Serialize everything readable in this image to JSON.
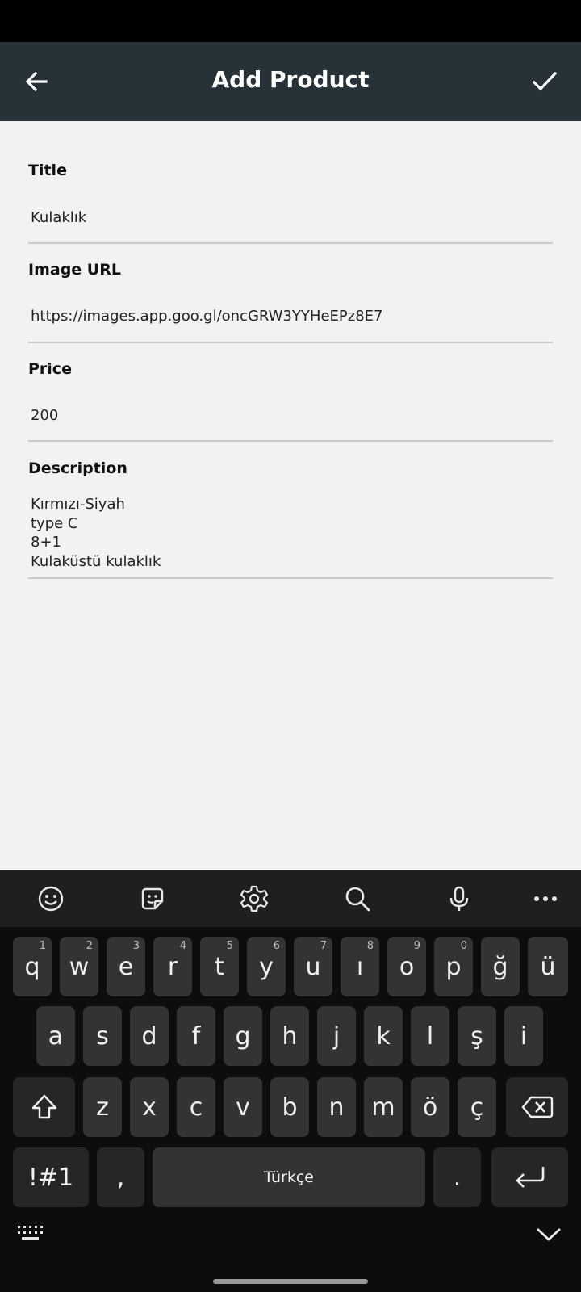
{
  "app_bar": {
    "title": "Add Product"
  },
  "form": {
    "title": {
      "label": "Title",
      "value": "Kulaklık"
    },
    "image_url": {
      "label": "Image URL",
      "value": "https://images.app.goo.gl/oncGRW3YYHeEPz8E7"
    },
    "price": {
      "label": "Price",
      "value": "200"
    },
    "description": {
      "label": "Description",
      "lines": [
        "Kırmızı-Siyah",
        "type C",
        "8+1",
        "Kulaküstü kulaklık"
      ]
    }
  },
  "keyboard": {
    "toolbar": [
      "emoji-icon",
      "sticker-icon",
      "settings-icon",
      "search-icon",
      "microphone-icon",
      "more-icon"
    ],
    "row1": [
      {
        "k": "q",
        "h": "1"
      },
      {
        "k": "w",
        "h": "2"
      },
      {
        "k": "e",
        "h": "3"
      },
      {
        "k": "r",
        "h": "4"
      },
      {
        "k": "t",
        "h": "5"
      },
      {
        "k": "y",
        "h": "6"
      },
      {
        "k": "u",
        "h": "7"
      },
      {
        "k": "ı",
        "h": "8"
      },
      {
        "k": "o",
        "h": "9"
      },
      {
        "k": "p",
        "h": "0"
      },
      {
        "k": "ğ",
        "h": ""
      },
      {
        "k": "ü",
        "h": ""
      }
    ],
    "row2": [
      "a",
      "s",
      "d",
      "f",
      "g",
      "h",
      "j",
      "k",
      "l",
      "ş",
      "i"
    ],
    "row3": [
      "z",
      "x",
      "c",
      "v",
      "b",
      "n",
      "m",
      "ö",
      "ç"
    ],
    "symbols_label": "!#1",
    "comma": ",",
    "space_label": "Türkçe",
    "period": "."
  },
  "colors": {
    "app_bar": "#263238",
    "background": "#f2f2f2",
    "key": "#333333"
  }
}
